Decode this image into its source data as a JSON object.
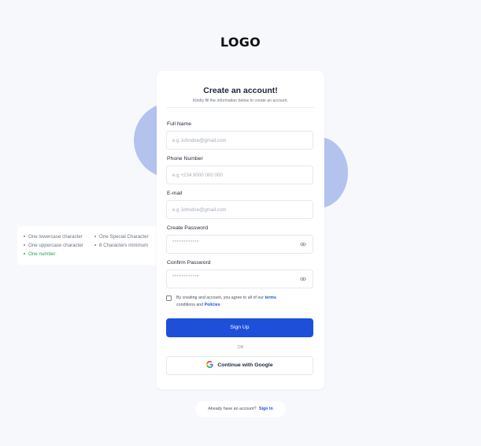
{
  "brand": {
    "logo": "LOGO"
  },
  "card": {
    "title": "Create an account!",
    "subtitle": "Kindly fill the information below to create an account."
  },
  "form": {
    "full_name": {
      "label": "Full Name",
      "placeholder": "e.g Johndoe@gmail.com"
    },
    "phone": {
      "label": "Phone Number",
      "placeholder": "e.g +234 9000 000 000"
    },
    "email": {
      "label": "E-mail",
      "placeholder": "e.g Johndoe@gmail.com"
    },
    "password": {
      "label": "Create Password",
      "value": "************"
    },
    "confirm_password": {
      "label": "Confirm Password",
      "value": "************"
    },
    "consent": {
      "checked": false,
      "text_before": "By creating and account, you agree to all of our ",
      "terms": "terms",
      "text_middle": " conditions and ",
      "policies": "Policies"
    },
    "signup_label": "Sign Up",
    "or_label": "OR",
    "google_label": "Continue with Google"
  },
  "password_requirements": [
    {
      "text": "One lowercase character",
      "met": false
    },
    {
      "text": "One Special Character",
      "met": false
    },
    {
      "text": "One uppercase character",
      "met": false
    },
    {
      "text": "8 Characters minimum",
      "met": false
    },
    {
      "text": "One number",
      "met": true
    }
  ],
  "footer": {
    "prompt": "Already have an account?",
    "signin_label": "Sign In"
  },
  "colors": {
    "primary": "#1d4fd8",
    "link": "#1a56db",
    "blob": "#b3c3ee",
    "success": "#22a35a",
    "background": "#f7f8fb"
  },
  "icons": [
    "eye-icon",
    "google-icon",
    "checkbox-icon"
  ]
}
